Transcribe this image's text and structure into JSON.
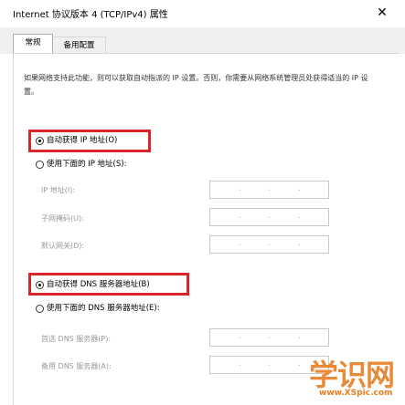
{
  "window": {
    "title": "Internet 协议版本 4 (TCP/IPv4) 属性",
    "close_glyph": "✕"
  },
  "tabs": [
    {
      "label": "常规"
    },
    {
      "label": "备用配置"
    }
  ],
  "description": "如果网络支持此功能，则可以获取自动指派的 IP 设置。否则，你需要从网络系统管理员处获得适当的 IP 设置。",
  "ip_section": {
    "auto_option": "自动获得 IP 地址(O)",
    "manual_option": "使用下面的 IP 地址(S):",
    "auto_checked": true,
    "fields": [
      {
        "label": "IP 地址(I):",
        "value": ". . ."
      },
      {
        "label": "子网掩码(U):",
        "value": ". . ."
      },
      {
        "label": "默认网关(D):",
        "value": ". . ."
      }
    ]
  },
  "dns_section": {
    "auto_option": "自动获得 DNS 服务器地址(B)",
    "manual_option": "使用下面的 DNS 服务器地址(E):",
    "auto_checked": true,
    "fields": [
      {
        "label": "首选 DNS 服务器(P):",
        "value": ". . ."
      },
      {
        "label": "备用 DNS 服务器(A):",
        "value": ". . ."
      }
    ]
  },
  "watermark": {
    "big": "学识网",
    "small": "www.XSpic.com",
    "color": "#e67e22"
  },
  "highlight_color": "#d8262b"
}
